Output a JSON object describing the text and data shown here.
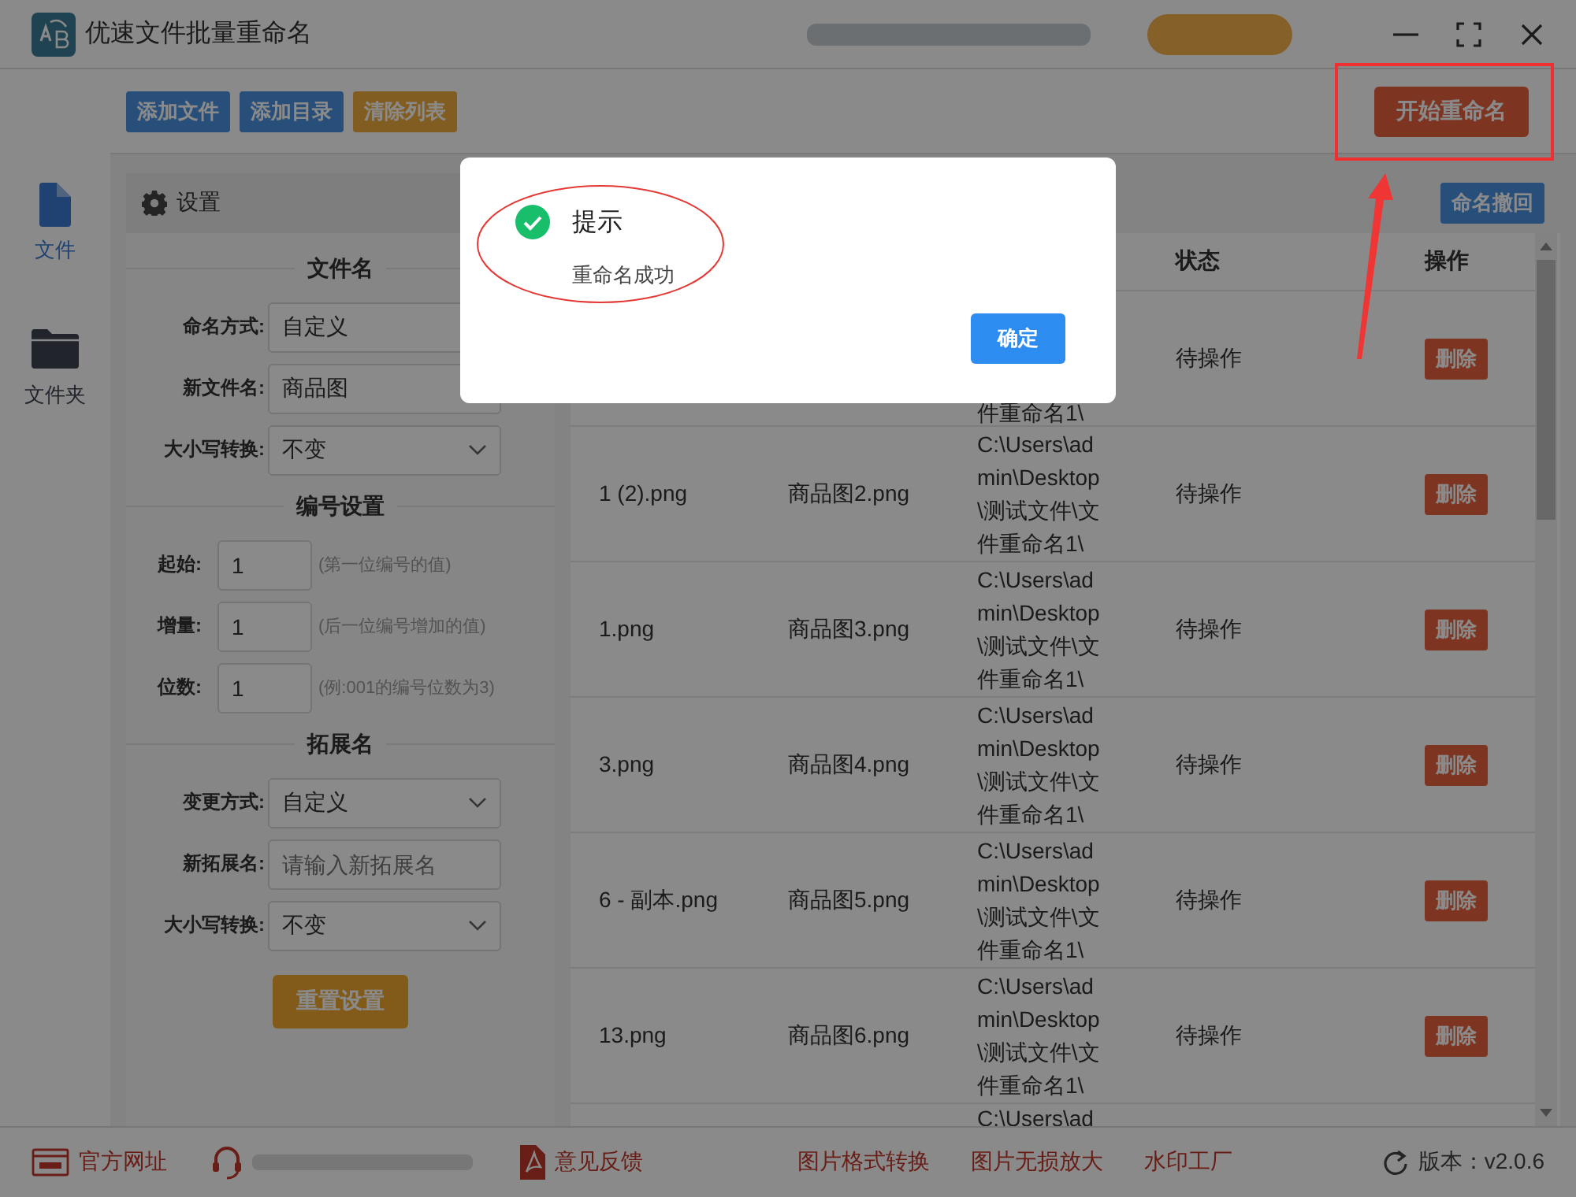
{
  "window": {
    "title": "优速文件批量重命名"
  },
  "toolbar": {
    "buttons": [
      {
        "label": "添加文件",
        "kind": "primary"
      },
      {
        "label": "添加目录",
        "kind": "primary"
      },
      {
        "label": "清除列表",
        "kind": "warning"
      }
    ],
    "start_button": "开始重命名"
  },
  "sidebar": {
    "items": [
      {
        "label": "文件",
        "kind": "file",
        "selected": true
      },
      {
        "label": "文件夹",
        "kind": "folder",
        "selected": false
      }
    ]
  },
  "settings": {
    "title": "设置",
    "sections": [
      {
        "heading": "文件名",
        "rows": [
          {
            "label": "命名方式:",
            "kind": "select",
            "value": "自定义"
          },
          {
            "label": "新文件名:",
            "kind": "input",
            "value": "商品图"
          },
          {
            "label": "大小写转换:",
            "kind": "select",
            "value": "不变"
          }
        ]
      },
      {
        "heading": "编号设置",
        "rows": [
          {
            "label": "起始:",
            "kind": "number",
            "value": "1",
            "hint": "(第一位编号的值)"
          },
          {
            "label": "增量:",
            "kind": "number",
            "value": "1",
            "hint": "(后一位编号增加的值)"
          },
          {
            "label": "位数:",
            "kind": "number",
            "value": "1",
            "hint": "(例:001的编号位数为3)"
          }
        ]
      },
      {
        "heading": "拓展名",
        "rows": [
          {
            "label": "变更方式:",
            "kind": "select",
            "value": "自定义"
          },
          {
            "label": "新拓展名:",
            "kind": "input",
            "placeholder": "请输入新拓展名"
          },
          {
            "label": "大小写转换:",
            "kind": "select",
            "value": "不变"
          }
        ]
      }
    ],
    "reset_button": "重置设置"
  },
  "table": {
    "undo_button": "命名撤回",
    "status_header": "状态",
    "action_header": "操作",
    "rows": [
      {
        "path": "件重命名1\\",
        "status": "待操作",
        "action": "删除"
      },
      {
        "original": "1 (2).png",
        "new_name": "商品图2.png",
        "path": "C:\\Users\\admin\\Desktop\\测试文件\\文件重命名1\\",
        "status": "待操作",
        "action": "删除"
      },
      {
        "original": "1.png",
        "new_name": "商品图3.png",
        "path": "C:\\Users\\admin\\Desktop\\测试文件\\文件重命名1\\",
        "status": "待操作",
        "action": "删除"
      },
      {
        "original": "3.png",
        "new_name": "商品图4.png",
        "path": "C:\\Users\\admin\\Desktop\\测试文件\\文件重命名1\\",
        "status": "待操作",
        "action": "删除"
      },
      {
        "original": "6 - 副本.png",
        "new_name": "商品图5.png",
        "path": "C:\\Users\\admin\\Desktop\\测试文件\\文件重命名1\\",
        "status": "待操作",
        "action": "删除"
      },
      {
        "original": "13.png",
        "new_name": "商品图6.png",
        "path": "C:\\Users\\admin\\Desktop\\测试文件\\文件重命名1\\",
        "status": "待操作",
        "action": "删除"
      },
      {
        "path": "C:\\Users\\ad"
      }
    ]
  },
  "footer": {
    "links": [
      {
        "label": "官方网址",
        "kind": "web"
      },
      {
        "kind": "phone"
      },
      {
        "label": "意见反馈",
        "kind": "pdf"
      },
      {
        "label": "图片格式转换",
        "kind": "text"
      },
      {
        "label": "图片无损放大",
        "kind": "text"
      },
      {
        "label": "水印工厂",
        "kind": "text"
      }
    ],
    "version": "版本：v2.0.6"
  },
  "dialog": {
    "kind": "success",
    "title": "提示",
    "message": "重命名成功",
    "button": "确定"
  }
}
